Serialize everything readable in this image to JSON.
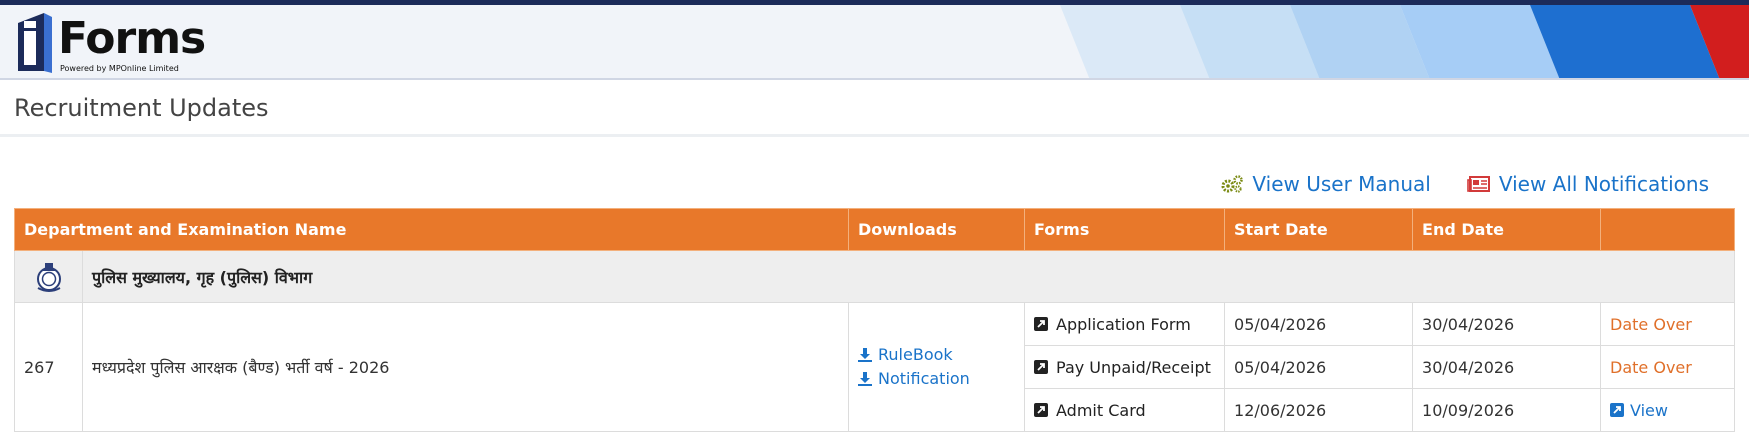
{
  "header": {
    "logo_text": "Forms",
    "logo_letter": "i",
    "logo_subtitle": "Powered by MPOnline Limited",
    "colors": {
      "navy": "#1c2b5a",
      "accent_blue": "#1e6fd0",
      "accent_red": "#d21e1e"
    }
  },
  "page": {
    "title": "Recruitment Updates"
  },
  "links": {
    "user_manual": {
      "label": "View User Manual",
      "icon": "gears-icon"
    },
    "all_notifications": {
      "label": "View All Notifications",
      "icon": "newspaper-icon"
    }
  },
  "table": {
    "headers": {
      "department": "Department and Examination Name",
      "downloads": "Downloads",
      "forms": "Forms",
      "start_date": "Start Date",
      "end_date": "End Date",
      "action": ""
    },
    "header_color": "#e8782a",
    "department": {
      "name": "पुलिस मुख्यालय, गृह (पुलिस) विभाग",
      "icon": "police-emblem-icon"
    },
    "exam": {
      "number": "267",
      "name": "मध्यप्रदेश पुलिस आरक्षक (बैण्ड) भर्ती वर्ष - 2026",
      "downloads": [
        {
          "label": "RuleBook",
          "icon": "download-icon"
        },
        {
          "label": "Notification",
          "icon": "download-icon"
        }
      ],
      "forms": [
        {
          "label": "Application Form",
          "start": "05/04/2026",
          "end": "30/04/2026",
          "status": "Date Over"
        },
        {
          "label": "Pay Unpaid/Receipt",
          "start": "05/04/2026",
          "end": "30/04/2026",
          "status": "Date Over"
        },
        {
          "label": "Admit Card",
          "start": "12/06/2026",
          "end": "10/09/2026",
          "status": "View"
        }
      ]
    }
  }
}
